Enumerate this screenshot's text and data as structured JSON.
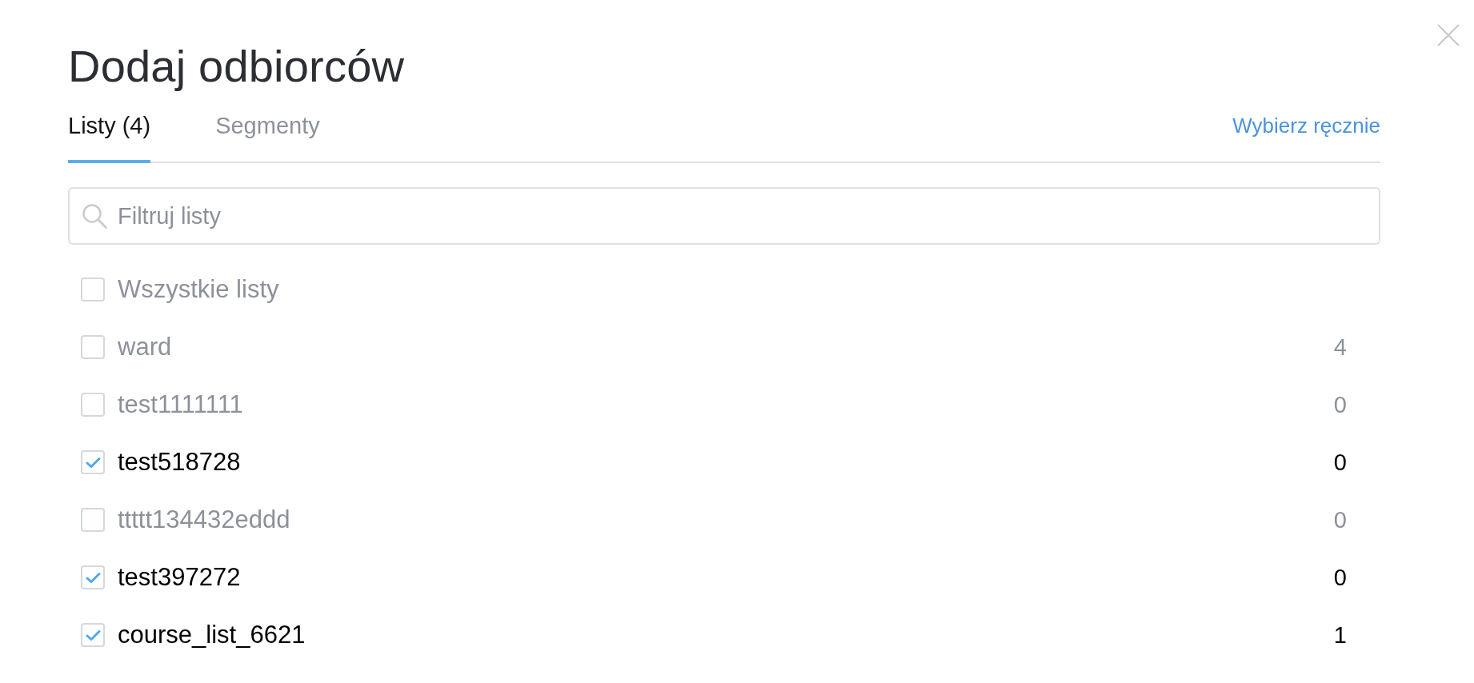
{
  "dialog": {
    "title": "Dodaj odbiorców"
  },
  "tabs": [
    {
      "label": "Listy (4)",
      "selected": true
    },
    {
      "label": "Segmenty",
      "selected": false
    }
  ],
  "manual_select_link": {
    "label": "Wybierz ręcznie"
  },
  "search": {
    "placeholder": "Filtruj listy"
  },
  "select_all": {
    "label": "Wszystkie listy",
    "checked": false
  },
  "lists": [
    {
      "name": "ward",
      "count": "4",
      "checked": false
    },
    {
      "name": "test1111111",
      "count": "0",
      "checked": false
    },
    {
      "name": "test518728",
      "count": "0",
      "checked": true
    },
    {
      "name": "ttttt134432eddd",
      "count": "0",
      "checked": false
    },
    {
      "name": "test397272",
      "count": "0",
      "checked": true
    },
    {
      "name": "course_list_6621",
      "count": "1",
      "checked": true
    }
  ]
}
